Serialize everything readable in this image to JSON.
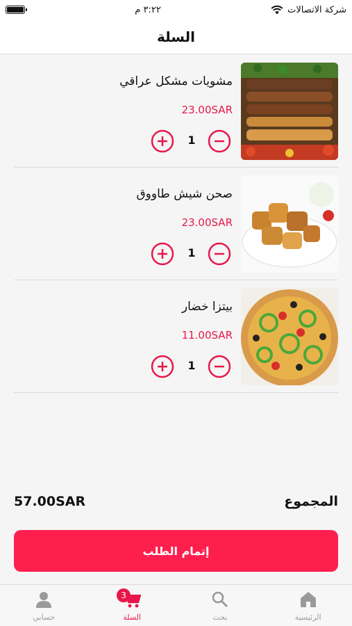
{
  "status_bar": {
    "carrier": "شركة الاتصالات",
    "time": "٣:٢٢ م"
  },
  "header": {
    "title": "السلة"
  },
  "cart": {
    "items": [
      {
        "name": "مشويات مشكل عراقي",
        "price": "23.00SAR",
        "quantity": "1",
        "image_icon": "mixed-grill-image"
      },
      {
        "name": "صحن شيش طاووق",
        "price": "23.00SAR",
        "quantity": "1",
        "image_icon": "shish-tawook-image"
      },
      {
        "name": "بيتزا خضار",
        "price": "11.00SAR",
        "quantity": "1",
        "image_icon": "veggie-pizza-image"
      }
    ]
  },
  "summary": {
    "total_label": "المجموع",
    "total_amount": "57.00SAR",
    "checkout_label": "إتمام الطلب"
  },
  "bottom_nav": {
    "items": [
      {
        "label": "الرئيسية",
        "icon": "home-icon"
      },
      {
        "label": "بحث",
        "icon": "search-icon"
      },
      {
        "label": "السلة",
        "icon": "cart-icon",
        "badge": "3",
        "active": true
      },
      {
        "label": "حسابي",
        "icon": "user-icon"
      }
    ]
  },
  "colors": {
    "accent": "#e8174a",
    "button": "#fe1f4e",
    "background": "#f5f5f5"
  }
}
